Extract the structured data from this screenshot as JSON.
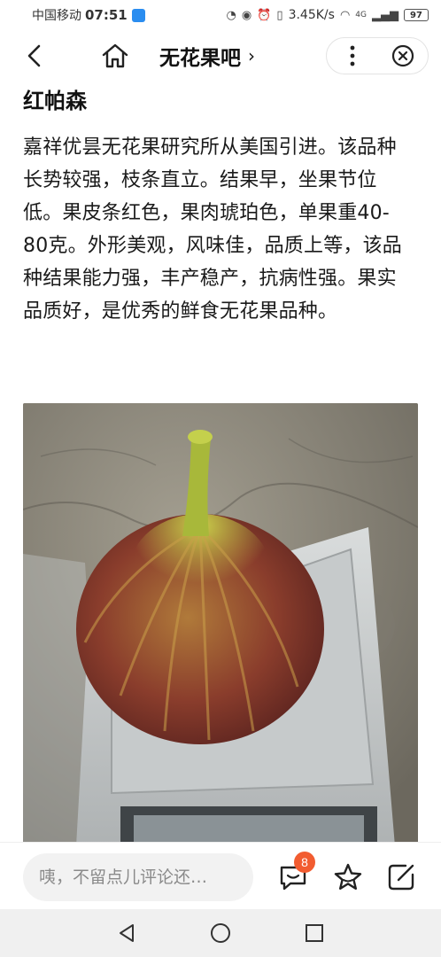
{
  "status_bar": {
    "carrier": "中国移动",
    "time": "07:51",
    "network_speed": "3.45K/s",
    "signal": "4G",
    "battery": "97"
  },
  "header": {
    "title": "无花果吧",
    "title_chevron": "›"
  },
  "article": {
    "variety_title": "红帕森",
    "paragraph": "嘉祥优昙无花果研究所从美国引进。该品种长势较强，枝条直立。结果早，坐果节位低。果皮条红色，果肉琥珀色，单果重40-80克。外形美观，风味佳，品质上等，该品种结果能力强，丰产稳产，抗病性强。果实品质好，是优秀的鲜食无花果品种。"
  },
  "bottom_bar": {
    "comment_placeholder": "咦，不留点儿评论还…",
    "comment_count": "8"
  },
  "icons": {
    "back": "chevron-left-icon",
    "home": "home-icon",
    "more": "more-vertical-icon",
    "close": "close-circle-icon",
    "comment": "comment-bubble-icon",
    "favorite": "star-icon",
    "share": "share-icon",
    "nav_back": "triangle-back-icon",
    "nav_home": "circle-home-icon",
    "nav_recent": "square-recent-icon"
  },
  "colors": {
    "badge": "#f25c30",
    "text": "#1a1a1a",
    "input_bg": "#f2f2f2"
  }
}
